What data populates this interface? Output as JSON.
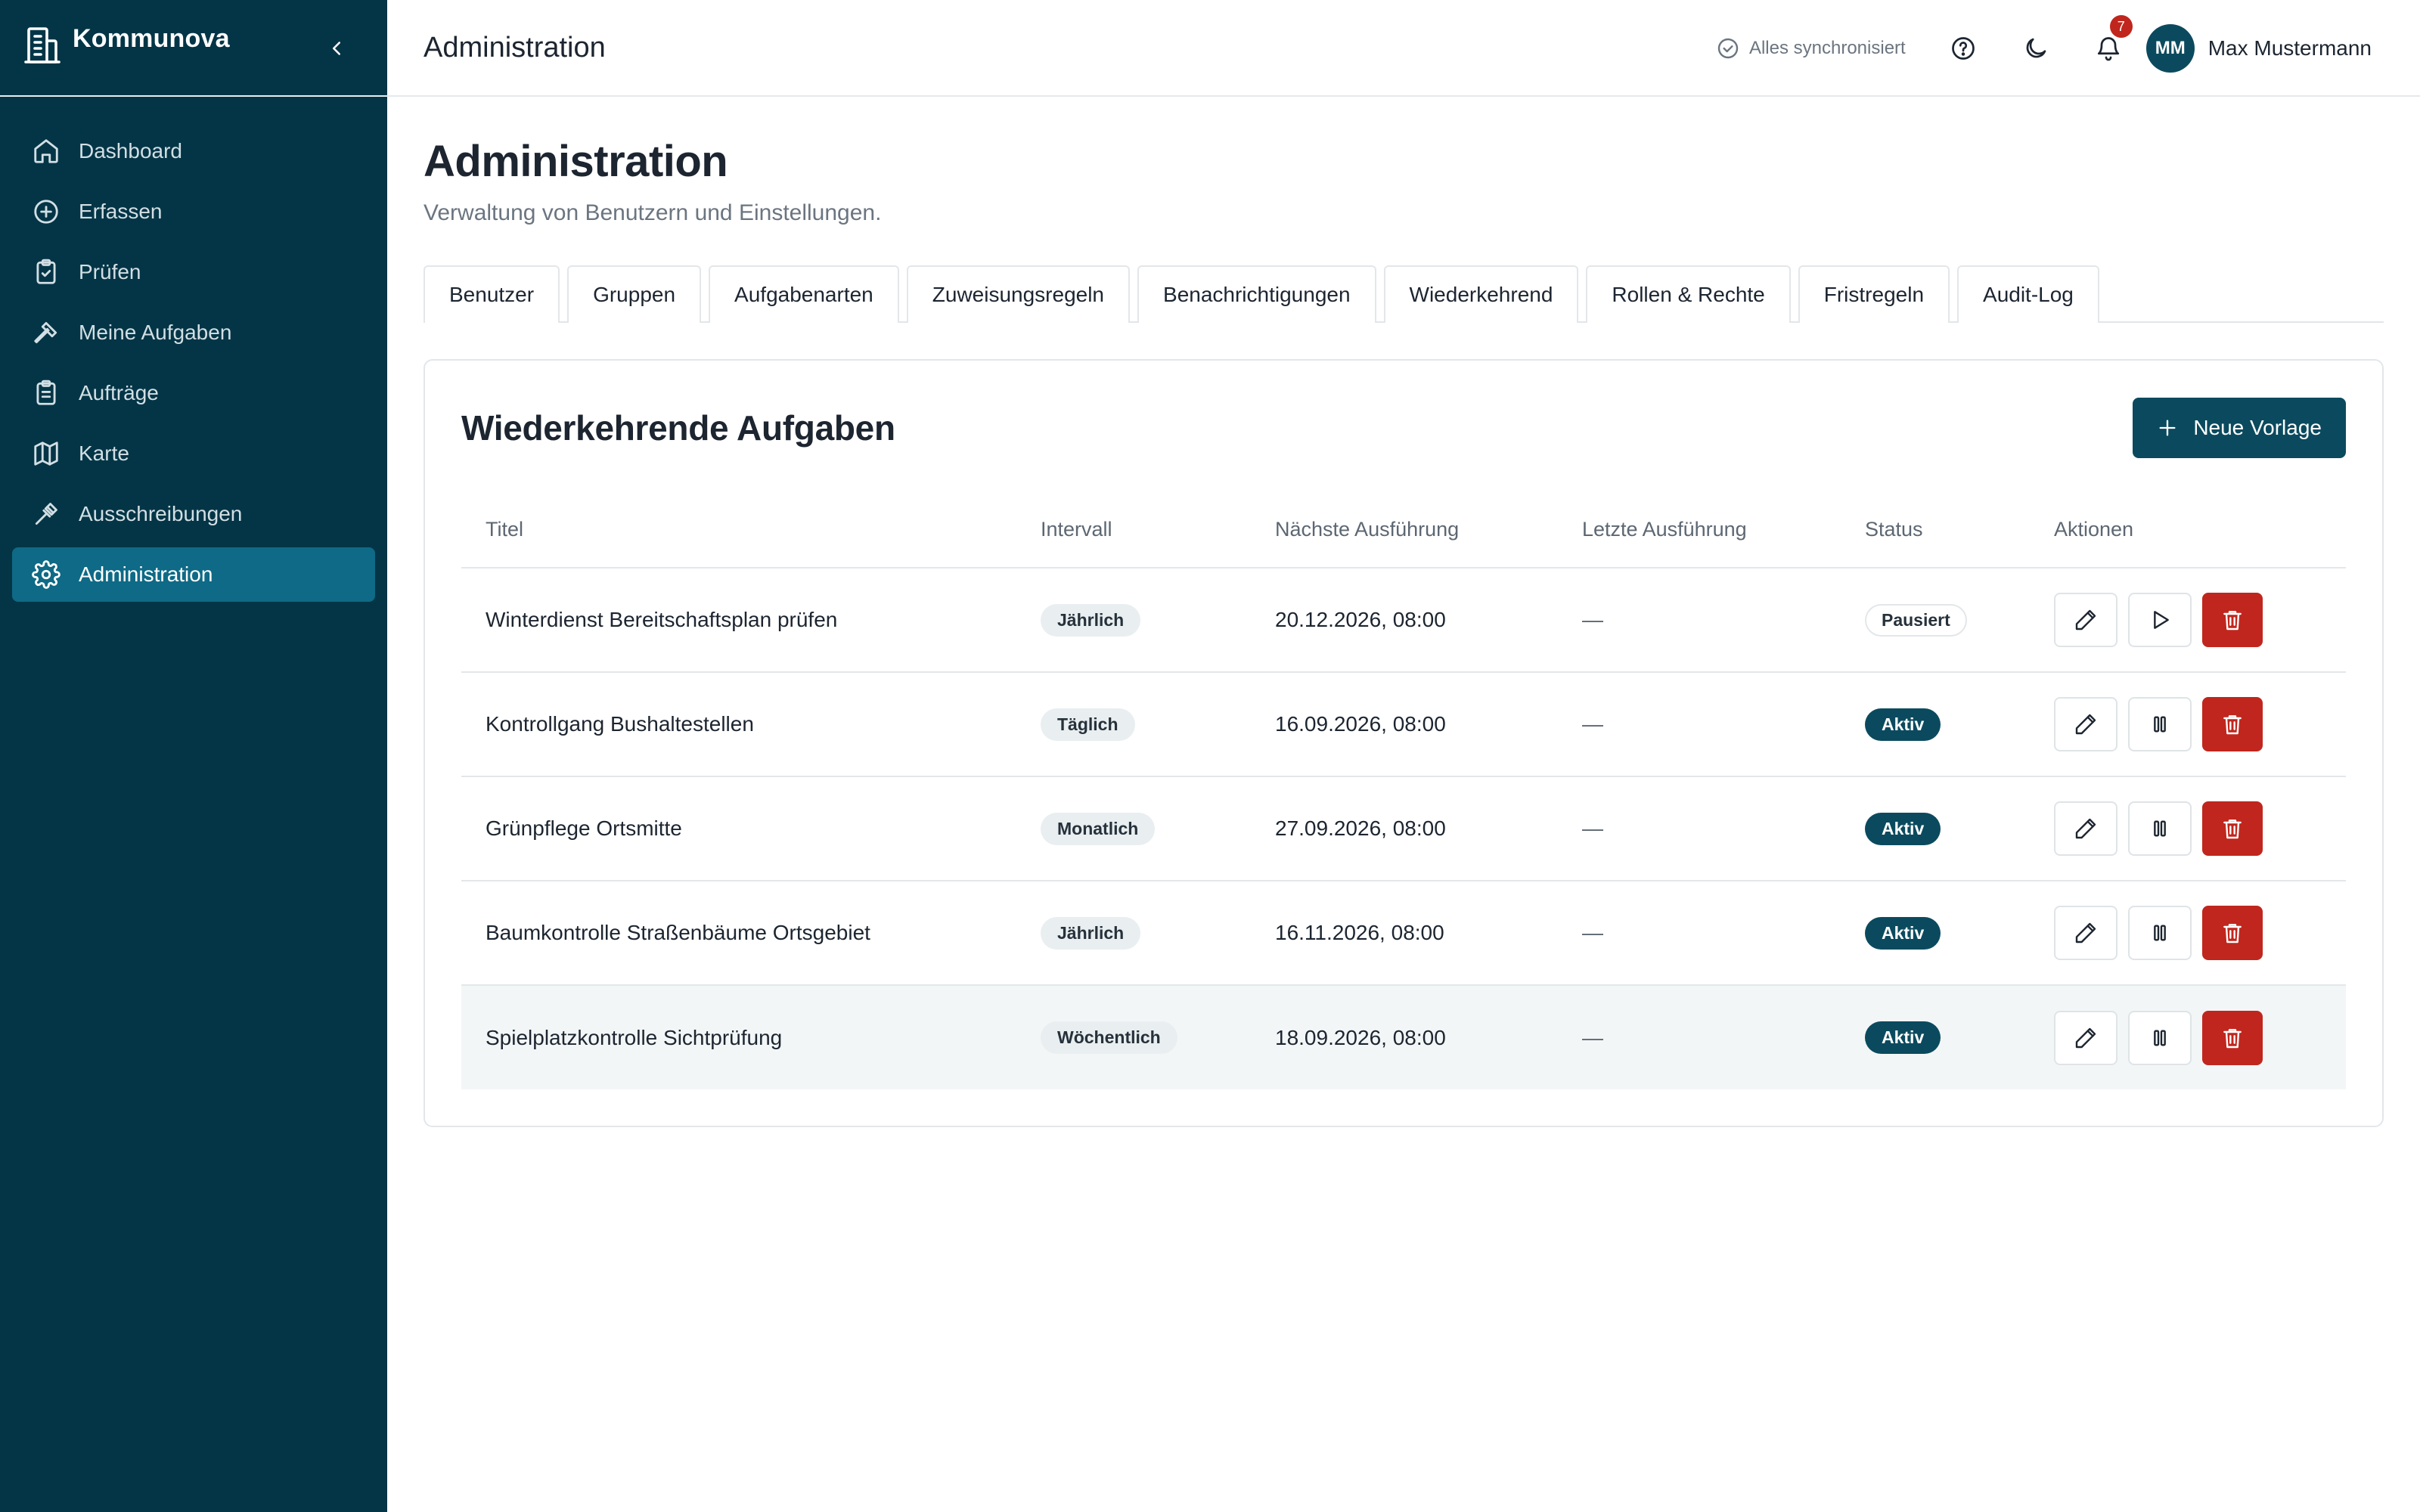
{
  "app": {
    "name": "Kommunova",
    "page_title": "Administration"
  },
  "sidebar": {
    "items": [
      {
        "label": "Dashboard",
        "icon": "home-icon"
      },
      {
        "label": "Erfassen",
        "icon": "plus-circle-icon"
      },
      {
        "label": "Prüfen",
        "icon": "clipboard-check-icon"
      },
      {
        "label": "Meine Aufgaben",
        "icon": "hammer-icon"
      },
      {
        "label": "Aufträge",
        "icon": "clipboard-list-icon"
      },
      {
        "label": "Karte",
        "icon": "map-icon"
      },
      {
        "label": "Ausschreibungen",
        "icon": "gavel-icon"
      },
      {
        "label": "Administration",
        "icon": "gear-icon"
      }
    ],
    "active_index": 7
  },
  "topbar": {
    "sync_status": "Alles synchronisiert",
    "notification_count": "7",
    "avatar_initials": "MM",
    "user_name": "Max Mustermann"
  },
  "main": {
    "title": "Administration",
    "subtitle": "Verwaltung von Benutzern und Einstellungen.",
    "tabs": [
      "Benutzer",
      "Gruppen",
      "Aufgabenarten",
      "Zuweisungsregeln",
      "Benachrichtigungen",
      "Wiederkehrend",
      "Rollen & Rechte",
      "Fristregeln",
      "Audit-Log"
    ],
    "active_tab": "Wiederkehrend"
  },
  "card": {
    "title": "Wiederkehrende Aufgaben",
    "new_button": "Neue Vorlage",
    "columns": [
      "Titel",
      "Intervall",
      "Nächste Ausführung",
      "Letzte Ausführung",
      "Status",
      "Aktionen"
    ],
    "rows": [
      {
        "title": "Winterdienst Bereitschaftsplan prüfen",
        "interval": "Jährlich",
        "next": "20.12.2026, 08:00",
        "last": "—",
        "status": "Pausiert"
      },
      {
        "title": "Kontrollgang Bushaltestellen",
        "interval": "Täglich",
        "next": "16.09.2026, 08:00",
        "last": "—",
        "status": "Aktiv"
      },
      {
        "title": "Grünpflege Ortsmitte",
        "interval": "Monatlich",
        "next": "27.09.2026, 08:00",
        "last": "—",
        "status": "Aktiv"
      },
      {
        "title": "Baumkontrolle Straßenbäume Ortsgebiet",
        "interval": "Jährlich",
        "next": "16.11.2026, 08:00",
        "last": "—",
        "status": "Aktiv"
      },
      {
        "title": "Spielplatzkontrolle Sichtprüfung",
        "interval": "Wöchentlich",
        "next": "18.09.2026, 08:00",
        "last": "—",
        "status": "Aktiv"
      }
    ]
  },
  "colors": {
    "sidebar_bg": "#043546",
    "sidebar_active": "#0e6a86",
    "primary": "#0b4a5e",
    "danger": "#c0261d"
  }
}
